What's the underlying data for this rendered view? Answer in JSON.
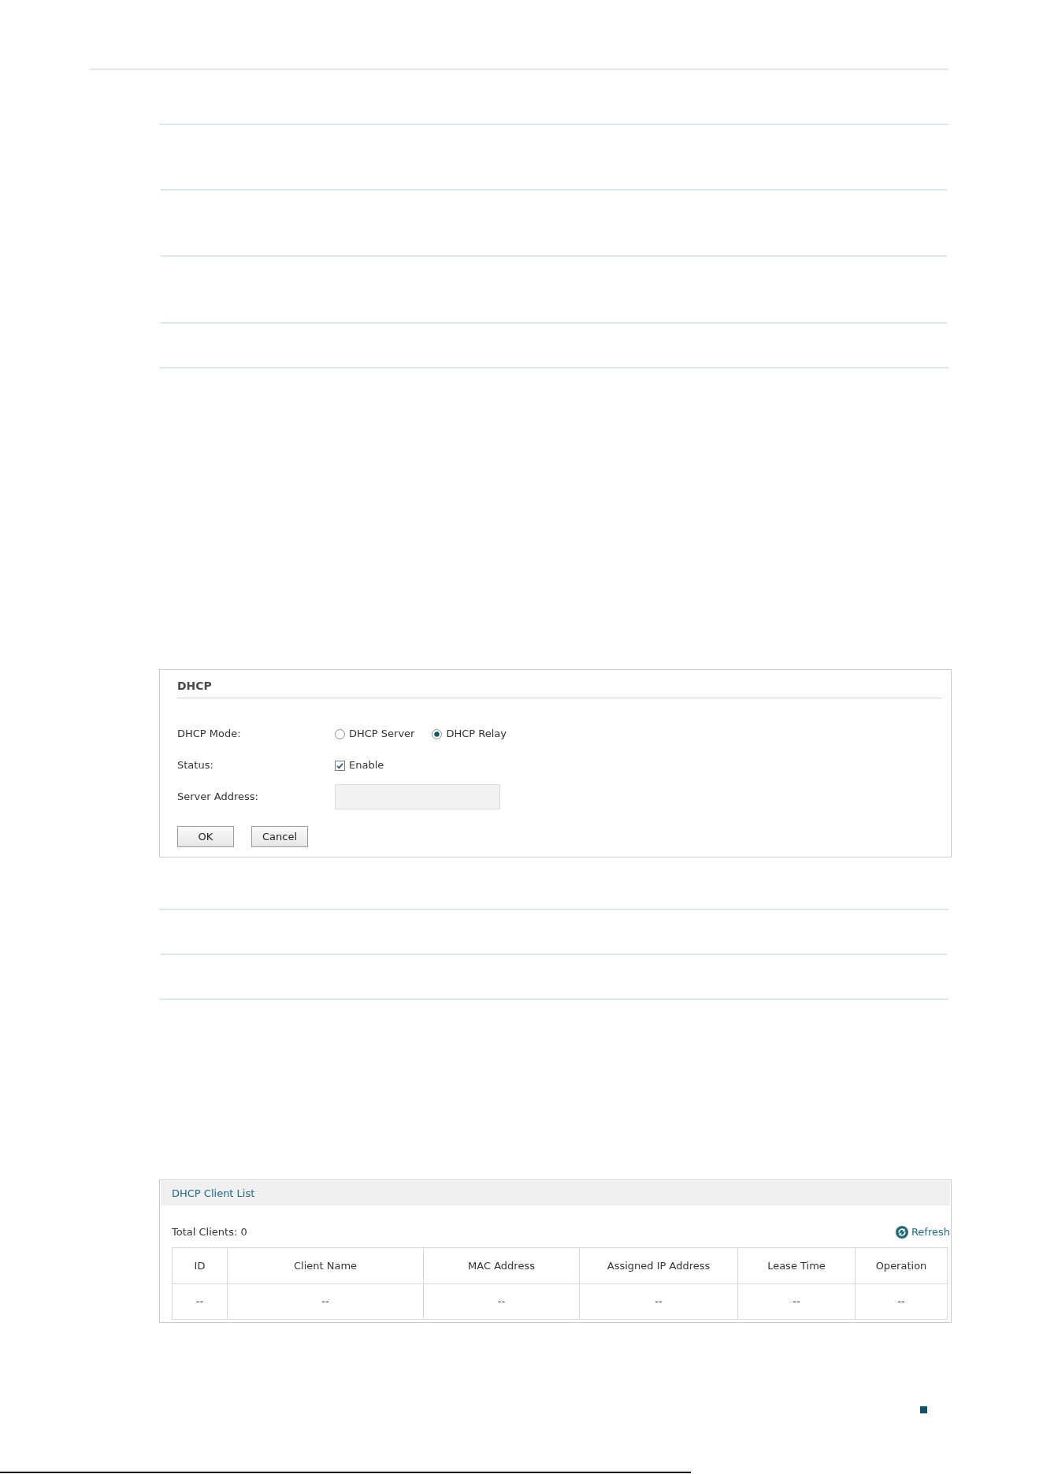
{
  "dhcp_panel": {
    "title": "DHCP",
    "fields": [
      {
        "kind": "radio",
        "label": "DHCP Mode:",
        "options": [
          {
            "label": "DHCP Server",
            "selected": false
          },
          {
            "label": "DHCP Relay",
            "selected": true
          }
        ]
      },
      {
        "kind": "checkbox",
        "label": "Status:",
        "option": {
          "label": "Enable",
          "checked": true
        }
      },
      {
        "kind": "input",
        "label": "Server Address:",
        "disabled": true
      }
    ],
    "buttons": [
      "OK",
      "Cancel"
    ]
  },
  "client_list_panel": {
    "title": "DHCP Client List",
    "total_clients": "Total Clients: 0",
    "refresh": "Refresh",
    "table": {
      "columns": [
        "ID",
        "Client Name",
        "MAC Address",
        "Assigned IP Address",
        "Lease Time",
        "Operation"
      ],
      "rows": [
        [
          "--",
          "--",
          "--",
          "--",
          "--",
          "--"
        ]
      ]
    }
  }
}
